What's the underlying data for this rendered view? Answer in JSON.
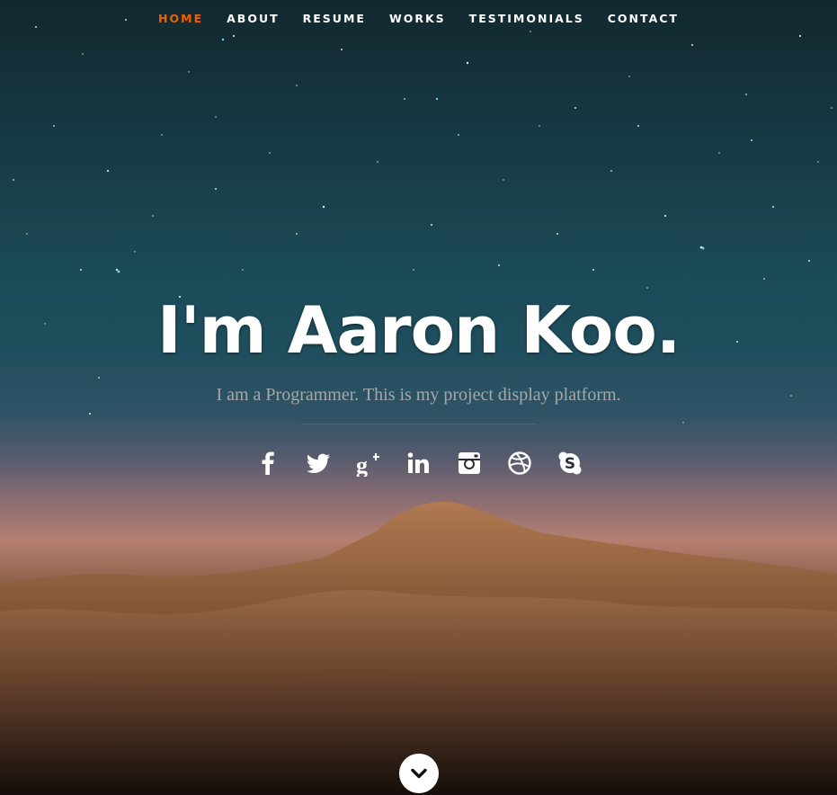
{
  "nav": {
    "items": [
      {
        "label": "HOME",
        "active": true
      },
      {
        "label": "ABOUT",
        "active": false
      },
      {
        "label": "RESUME",
        "active": false
      },
      {
        "label": "WORKS",
        "active": false
      },
      {
        "label": "TESTIMONIALS",
        "active": false
      },
      {
        "label": "CONTACT",
        "active": false
      }
    ],
    "active_color": "#f06000"
  },
  "banner": {
    "headline": "I'm Aaron Koo.",
    "tagline": "I am a Programmer. This is my project display platform."
  },
  "social": [
    {
      "icon": "facebook-icon"
    },
    {
      "icon": "twitter-icon"
    },
    {
      "icon": "google-plus-icon"
    },
    {
      "icon": "linkedin-icon"
    },
    {
      "icon": "instagram-icon"
    },
    {
      "icon": "dribbble-icon"
    },
    {
      "icon": "skype-icon"
    }
  ],
  "scroll": {
    "icon": "chevron-down-icon"
  }
}
